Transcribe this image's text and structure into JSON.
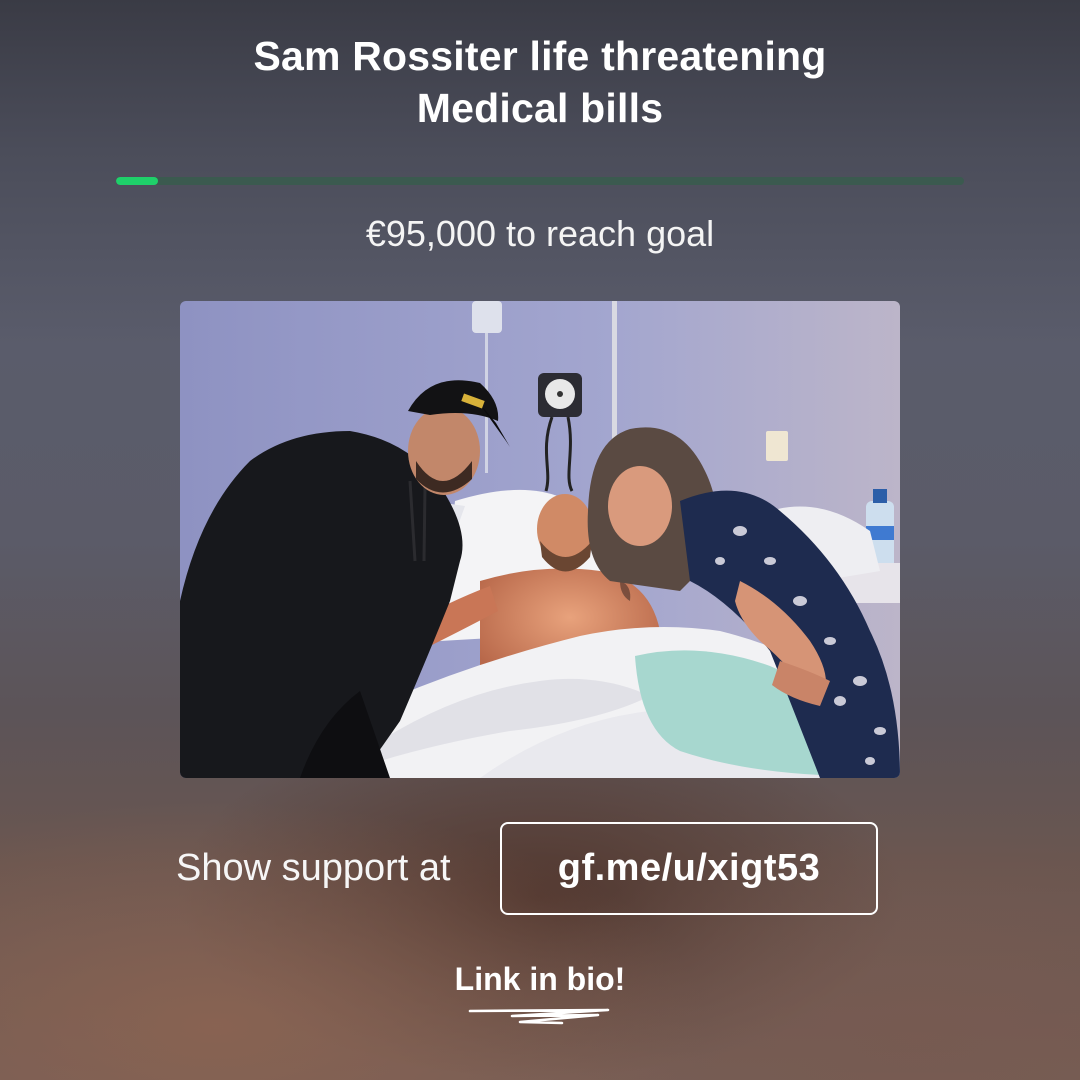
{
  "campaign": {
    "title_line1": "Sam Rossiter life threatening",
    "title_line2": "Medical bills",
    "progress_fraction": 0.05,
    "goal_remaining_text": "€95,000 to reach goal"
  },
  "photo": {
    "alt": "Sam Rossiter in hospital bed with family"
  },
  "cta": {
    "support_label": "Show support at",
    "link": "gf.me/u/xigt53",
    "bio_label": "Link in bio!"
  },
  "colors": {
    "progress_fill": "#1fd06a",
    "progress_track": "#3b5a4f",
    "text": "#ffffff"
  }
}
